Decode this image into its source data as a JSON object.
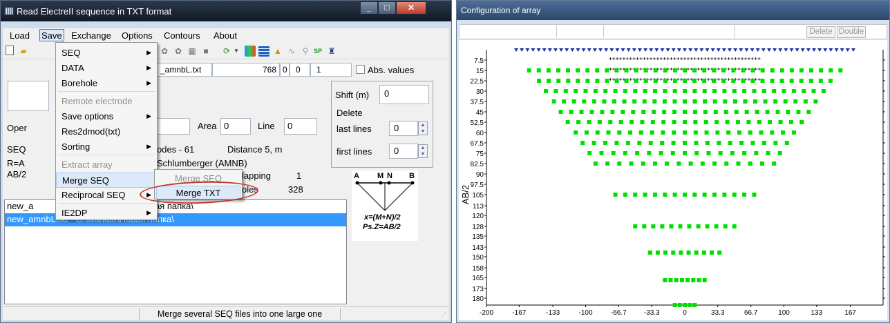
{
  "window1": {
    "title": "Read ElectreII sequence in TXT format",
    "menubar": [
      "Load",
      "Save",
      "Exchange",
      "Options",
      "Contours",
      "About"
    ],
    "filename_field": "_amnbL.txt",
    "counts": [
      "768",
      "0",
      "0",
      "1"
    ],
    "abs_values_label": "Abs. values",
    "shift_label": "Shift (m)",
    "shift_value": "0",
    "delete_label": "Delete",
    "last_lines_label": "last lines",
    "last_lines_value": "0",
    "first_lines_label": "first lines",
    "first_lines_value": "0",
    "oper_label": "Oper",
    "area_label": "Area",
    "area_value": "0",
    "line_label": "Line",
    "line_value": "0",
    "seq_label": "SEQ",
    "electrodes_text": "odes -  61",
    "distance_text": "Distance  5, m",
    "ra_label": "R=A",
    "array_type": "Schlumberger (AMNB)",
    "ab2_label": "AB/2",
    "overlapping_text": "lapping",
    "overlapping_value": "1",
    "poles_text": "oles",
    "poles_value": "328",
    "list_items": [
      "new_a",
      "new_amnbL.txt - G:\\workdir\\Новая папка\\"
    ],
    "list_item0_suffix": "ая папка\\",
    "status_text": "Merge several SEQ files into one large one",
    "save_menu": {
      "items": [
        {
          "label": "SEQ",
          "submenu": true,
          "disabled": false
        },
        {
          "label": "DATA",
          "submenu": true,
          "disabled": false
        },
        {
          "label": "Borehole",
          "submenu": true,
          "disabled": false
        },
        {
          "label": "Remote electrode",
          "submenu": false,
          "disabled": true
        },
        {
          "label": "Save options",
          "submenu": true,
          "disabled": false
        },
        {
          "label": "Res2dmod(txt)",
          "submenu": false,
          "disabled": false
        },
        {
          "label": "Sorting",
          "submenu": true,
          "disabled": false
        },
        {
          "label": "Extract array",
          "submenu": false,
          "disabled": true
        },
        {
          "label": "Merge SEQ",
          "submenu": false,
          "disabled": false,
          "highlighted": true
        },
        {
          "label": "Reciprocal SEQ",
          "submenu": true,
          "disabled": false
        },
        {
          "label": "IE2DP",
          "submenu": true,
          "disabled": false
        }
      ]
    },
    "merge_submenu": {
      "items": [
        {
          "label": "Merge SEQ",
          "disabled": true
        },
        {
          "label": "Merge TXT",
          "disabled": false,
          "highlighted": true
        }
      ]
    },
    "diagram": {
      "labels": [
        "A",
        "M",
        "N",
        "B"
      ],
      "formula1": "x=(M+N)/2",
      "formula2": "Ps.Z=AB/2"
    },
    "toolbar_icons": [
      "new-icon",
      "open-icon",
      "tool-icon",
      "tool-icon",
      "tool-icon",
      "square-icon",
      "refresh-icon",
      "dropdown-icon",
      "chart-icon",
      "grid-icon",
      "electrode-icon",
      "wave-icon",
      "probe-icon",
      "sp-icon",
      "person-icon"
    ],
    "sp_label": "SP"
  },
  "window2": {
    "title": "Configuration of array",
    "delete_button": "Delete",
    "double_button": "Double"
  },
  "chart_data": {
    "type": "scatter",
    "title": "",
    "xlabel": "",
    "ylabel": "AB/2",
    "x_ticks": [
      "-200",
      "-167",
      "-133",
      "-100",
      "-66.7",
      "-33.3",
      "0",
      "33.3",
      "66.7",
      "100",
      "133",
      "167"
    ],
    "y_ticks": [
      "7.5",
      "15",
      "22.5",
      "30",
      "37.5",
      "45",
      "52.5",
      "60",
      "67.5",
      "75",
      "82.5",
      "90",
      "97.5",
      "105",
      "113",
      "120",
      "128",
      "135",
      "143",
      "150",
      "158",
      "165",
      "173",
      "180"
    ],
    "xlim": [
      -200,
      200
    ],
    "ylim": [
      0,
      185
    ],
    "y_inverted": true,
    "electrodes": {
      "x_start": -170,
      "x_end": 170,
      "y": 0,
      "marker": "triangle-down"
    },
    "measurement_points": {
      "y": [
        7.5,
        15,
        22.5
      ],
      "x_range": [
        -75,
        75
      ],
      "marker": "plus"
    },
    "series": [
      {
        "y": 15,
        "x_range": [
          -157,
          157
        ],
        "count": 33
      },
      {
        "y": 22.5,
        "x_range": [
          -147,
          147
        ],
        "count": 31
      },
      {
        "y": 30,
        "x_range": [
          -140,
          140
        ],
        "count": 29
      },
      {
        "y": 37.5,
        "x_range": [
          -132,
          132
        ],
        "count": 27
      },
      {
        "y": 45,
        "x_range": [
          -125,
          125
        ],
        "count": 25
      },
      {
        "y": 52.5,
        "x_range": [
          -118,
          118
        ],
        "count": 23
      },
      {
        "y": 60,
        "x_range": [
          -110,
          110
        ],
        "count": 21
      },
      {
        "y": 67.5,
        "x_range": [
          -103,
          103
        ],
        "count": 19
      },
      {
        "y": 75,
        "x_range": [
          -96,
          96
        ],
        "count": 17
      },
      {
        "y": 82.5,
        "x_range": [
          -90,
          90
        ],
        "count": 16
      },
      {
        "y": 105,
        "x_range": [
          -70,
          70
        ],
        "count": 15
      },
      {
        "y": 128,
        "x_range": [
          -50,
          50
        ],
        "count": 12
      },
      {
        "y": 147,
        "x_range": [
          -35,
          35
        ],
        "count": 10
      },
      {
        "y": 167,
        "x_range": [
          -20,
          20
        ],
        "count": 8
      },
      {
        "y": 185,
        "x_range": [
          -10,
          10
        ],
        "count": 5
      }
    ],
    "marker_color": "#00e000",
    "triangle_color": "#1c2ea8",
    "grid": false
  }
}
